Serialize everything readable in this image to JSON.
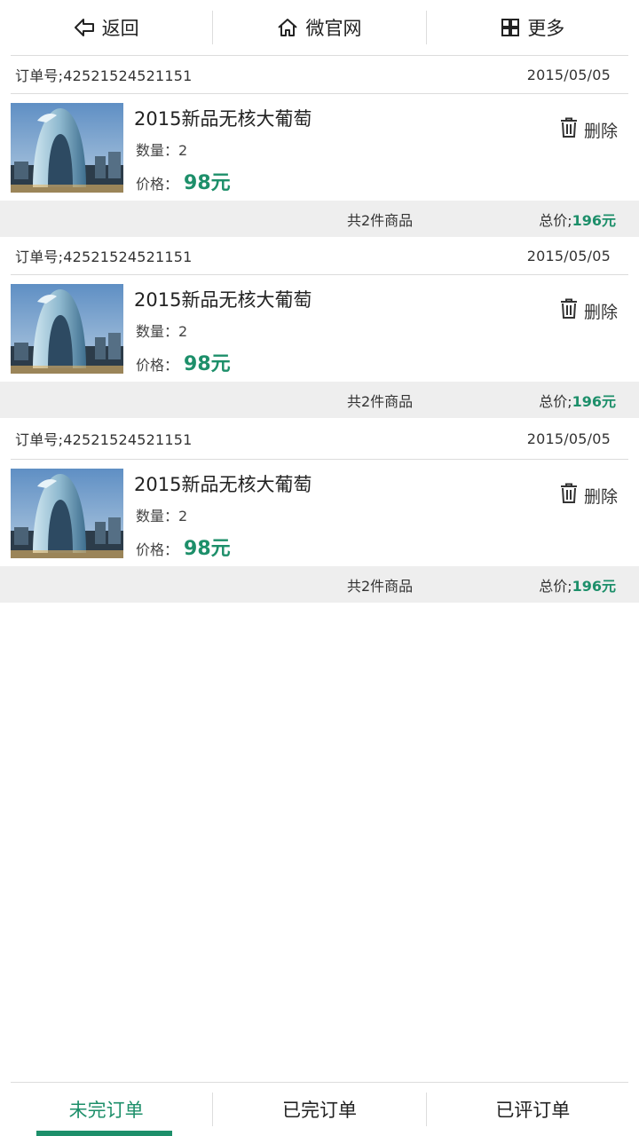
{
  "topnav": {
    "back_label": "返回",
    "home_label": "微官网",
    "more_label": "更多"
  },
  "orders": [
    {
      "order_no": "订单号;42521524521151",
      "date": "2015/05/05",
      "product": "2015新品无核大葡萄",
      "qty_label": "数量：2",
      "price_label": "价格：",
      "price": "98元",
      "delete_label": "删除",
      "count_label": "共2件商品",
      "total_label": "总价;",
      "total_value": "196元"
    },
    {
      "order_no": "订单号;42521524521151",
      "date": "2015/05/05",
      "product": "2015新品无核大葡萄",
      "qty_label": "数量：2",
      "price_label": "价格：",
      "price": "98元",
      "delete_label": "删除",
      "count_label": "共2件商品",
      "total_label": "总价;",
      "total_value": "196元"
    },
    {
      "order_no": "订单号;42521524521151",
      "date": "2015/05/05",
      "product": "2015新品无核大葡萄",
      "qty_label": "数量：2",
      "price_label": "价格：",
      "price": "98元",
      "delete_label": "删除",
      "count_label": "共2件商品",
      "total_label": "总价;",
      "total_value": "196元"
    }
  ],
  "bottomnav": {
    "tabs": [
      {
        "label": "未完订单",
        "active": true
      },
      {
        "label": "已完订单",
        "active": false
      },
      {
        "label": "已评订单",
        "active": false
      }
    ]
  },
  "colors": {
    "accent": "#1d8f6a",
    "footer_bg": "#eeeeee"
  },
  "icons": [
    "back-arrow-icon",
    "home-icon",
    "grid-icon",
    "trash-icon"
  ]
}
